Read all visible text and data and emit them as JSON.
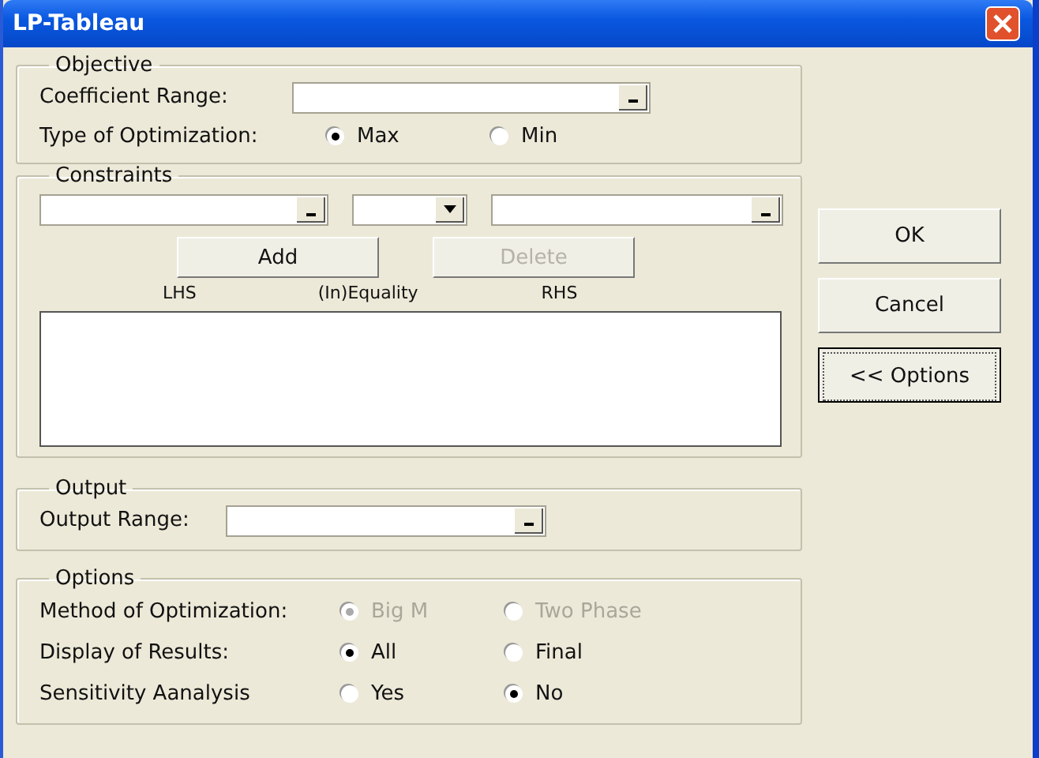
{
  "window": {
    "title": "LP-Tableau"
  },
  "objective": {
    "title": "Objective",
    "coefficient_range": {
      "label": "Coefficient Range:"
    },
    "type_of_optimization": {
      "label": "Type of Optimization:",
      "disabled": false,
      "choices": [
        {
          "label": "Max",
          "selected": true
        },
        {
          "label": "Min",
          "selected": false
        }
      ]
    }
  },
  "constraints": {
    "title": "Constraints",
    "add_button": {
      "label": "Add",
      "disabled": false
    },
    "delete_button": {
      "label": "Delete",
      "disabled": true
    },
    "columns": [
      "LHS",
      "(In)Equality",
      "RHS"
    ]
  },
  "output": {
    "title": "Output",
    "output_range": {
      "label": "Output Range:"
    }
  },
  "options": {
    "title": "Options",
    "rows": [
      {
        "label": "Method of Optimization:",
        "disabled": true,
        "choices": [
          {
            "label": "Big M",
            "selected": true
          },
          {
            "label": "Two Phase",
            "selected": false
          }
        ]
      },
      {
        "label": "Display of Results:",
        "disabled": false,
        "choices": [
          {
            "label": "All",
            "selected": true
          },
          {
            "label": "Final",
            "selected": false
          }
        ]
      },
      {
        "label": "Sensitivity Aanalysis",
        "disabled": false,
        "choices": [
          {
            "label": "Yes",
            "selected": false
          },
          {
            "label": "No",
            "selected": true
          }
        ]
      }
    ]
  },
  "buttons": [
    {
      "label": "OK",
      "focused": false
    },
    {
      "label": "Cancel",
      "focused": false
    },
    {
      "label": "<< Options",
      "focused": true
    }
  ]
}
